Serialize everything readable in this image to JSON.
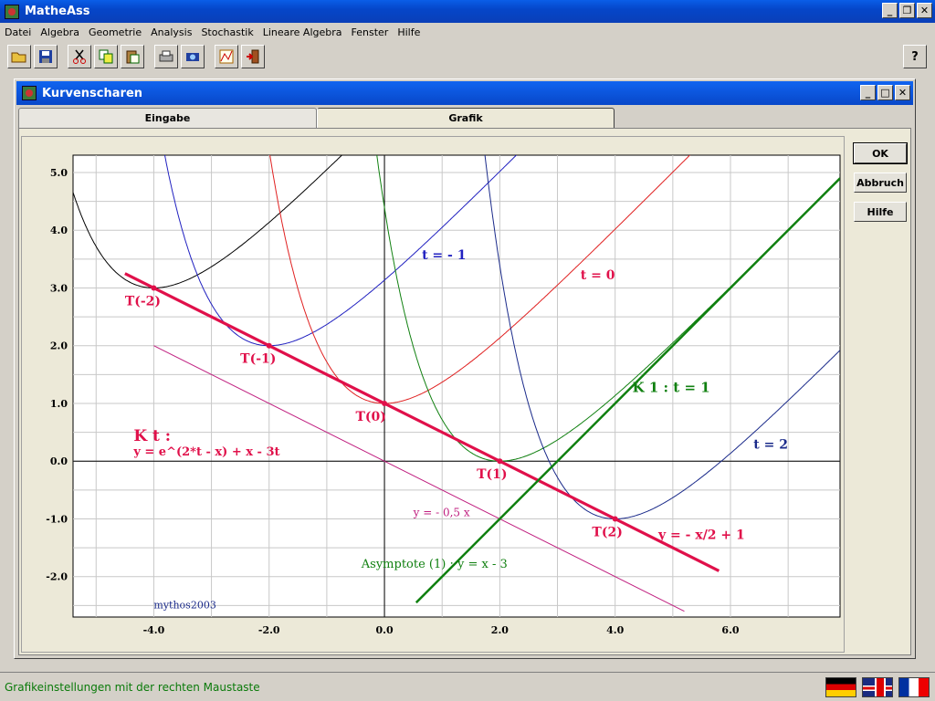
{
  "app": {
    "title": "MatheAss"
  },
  "menu": [
    "Datei",
    "Algebra",
    "Geometrie",
    "Analysis",
    "Stochastik",
    "Lineare Algebra",
    "Fenster",
    "Hilfe"
  ],
  "toolbar": [
    "open-icon",
    "save-icon",
    "cut-icon",
    "copy-icon",
    "paste-icon",
    "print-icon",
    "camera-icon",
    "chart-icon",
    "exit-icon",
    "help-icon"
  ],
  "child": {
    "title": "Kurvenscharen",
    "tabs": [
      "Eingabe",
      "Grafik"
    ],
    "active_tab": "Grafik",
    "buttons": {
      "ok": "OK",
      "cancel": "Abbruch",
      "help": "Hilfe"
    }
  },
  "status": {
    "text": "Grafikeinstellungen mit der rechten Maustaste"
  },
  "flags": [
    "de-flag",
    "uk-flag",
    "fr-flag"
  ],
  "chart_data": {
    "type": "line",
    "title": "",
    "xlim": [
      -5.4,
      7.9
    ],
    "ylim": [
      -2.7,
      5.3
    ],
    "x_ticks": [
      "-4.0",
      "-2.0",
      "0.0",
      "2.0",
      "4.0",
      "6.0"
    ],
    "y_ticks": [
      "5.0",
      "4.0",
      "3.0",
      "2.0",
      "1.0",
      "0.0",
      "-1.0",
      "-2.0"
    ],
    "grid": true,
    "function_family": "f_t(x) = e^(2t - x) + x - 3t",
    "series": [
      {
        "name": "t = - 1",
        "t": -1,
        "color": "#2020c0"
      },
      {
        "name": "t = 0",
        "t": 0,
        "color": "#e02020"
      },
      {
        "name": "K 1 : t = 1",
        "t": 1,
        "color": "#108010"
      },
      {
        "name": "t = 2",
        "t": 2,
        "color": "#1a2a8a"
      }
    ],
    "extra_curves": [
      {
        "t": -2,
        "color": "#000000"
      }
    ],
    "lines": [
      {
        "name": "y = - x/2 + 1",
        "slope": -0.5,
        "intercept": 1,
        "x_range": [
          -4.5,
          5.8
        ],
        "color": "#e0104a"
      },
      {
        "name": "y = - 0,5 x",
        "slope": -0.5,
        "intercept": 0,
        "x_range": [
          -4.0,
          5.2
        ],
        "color": "#c02080"
      },
      {
        "name": "Asymptote (1) :   y = x - 3",
        "slope": 1,
        "intercept": -3,
        "x_range": [
          0.55,
          7.9
        ],
        "color": "#108010"
      }
    ],
    "points": [
      {
        "label": "T(-2)",
        "x": -4,
        "y": 3
      },
      {
        "label": "T(-1)",
        "x": -2,
        "y": 2
      },
      {
        "label": "T(0)",
        "x": 0,
        "y": 1
      },
      {
        "label": "T(1)",
        "x": 2,
        "y": 0
      },
      {
        "label": "T(2)",
        "x": 4,
        "y": -1
      }
    ],
    "annotations": {
      "family_title": "K t :",
      "family_formula": "y = e^(2*t - x) + x - 3t",
      "credit": "mythos2003"
    }
  }
}
